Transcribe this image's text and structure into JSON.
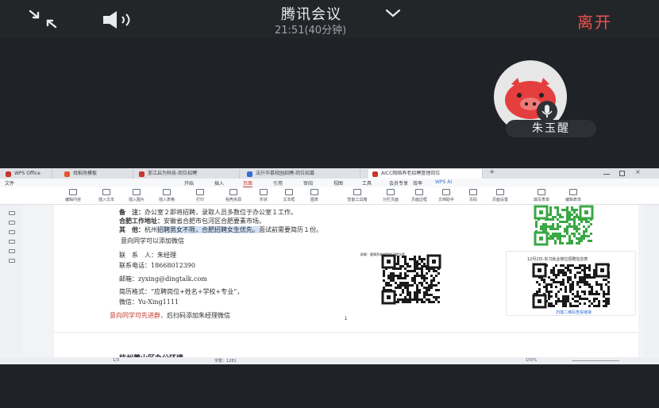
{
  "meeting": {
    "title": "腾讯会议",
    "time": "21:51(40分钟)",
    "leave_label": "离开"
  },
  "participant": {
    "name": "朱玉醒"
  },
  "browser_tabs": [
    {
      "label": "WPS Office",
      "color": "#c8372d"
    },
    {
      "label": "找稻壳模板",
      "color": "#e2572c"
    },
    {
      "label": "浙江启为科技-岗位招聘",
      "color": "#c8372d"
    },
    {
      "label": "法升华慕校园招聘-岗位招募",
      "color": "#2f6fd6"
    },
    {
      "label": "AICC网络养老招聘管理岗位",
      "color": "#c8372d"
    }
  ],
  "menu": [
    "文件",
    "开始",
    "插入",
    "页面",
    "引用",
    "审阅",
    "视图",
    "工具",
    "会员专享",
    "效率",
    "WPS AI"
  ],
  "menu_selected": "页面",
  "ribbon": [
    "编辑内容",
    "插入文本",
    "插入图片",
    "插入表格",
    "打印",
    "稻壳资源",
    "形状",
    "文本框",
    "图表",
    "智能工具箱",
    "分栏页面",
    "页面边框",
    "文档助手",
    "页码",
    "页面设置",
    "填写表单",
    "编辑表单"
  ],
  "document": {
    "line_remark_label": "备　注：",
    "line_remark": "办公室２即将招聘，录取人员多数位于办公室１工作。",
    "line_addr_label": "合肥工作地址：",
    "line_addr": "安徽省合肥市包河区合肥要素市场。",
    "line_other_label": "其　他：",
    "line_other_a": "杭州",
    "line_other_hl": "招聘男女不限，合肥招聘女生优先。",
    "line_other_b": "面试前需要简历１份。",
    "wechat_note": "意向同学可以添加微信",
    "contact_label": "联　系　人：",
    "contact_name": "朱经理",
    "phone_label": "联系电话：",
    "phone": "18668012390",
    "email_label": "邮箱：",
    "email": "zyxing@dingtalk.com",
    "resume_label": "简历格式：",
    "resume_format": "“应聘岗位+姓名+学校+专业”，",
    "wechat_label": "微信：",
    "wechat": "Yu-Xing1111",
    "cta_red": "意向同学可先进群，",
    "cta_rest": "后扫码添加朱经理微信",
    "page_number": "1",
    "qr_caption": "群聊：健康养老学院实习就业群",
    "card_title": "12月2日-实习就业岗位招聘信息表",
    "card_link": "扫描二维码查看链接",
    "next_heading": "杭州萧山区办公环境"
  },
  "status": {
    "page": "1/3",
    "words": "字数：1281",
    "zoom": "150%"
  },
  "colors": {
    "leave": "#e8524d",
    "accent": "#c23b32",
    "link": "#2f6fd6"
  }
}
